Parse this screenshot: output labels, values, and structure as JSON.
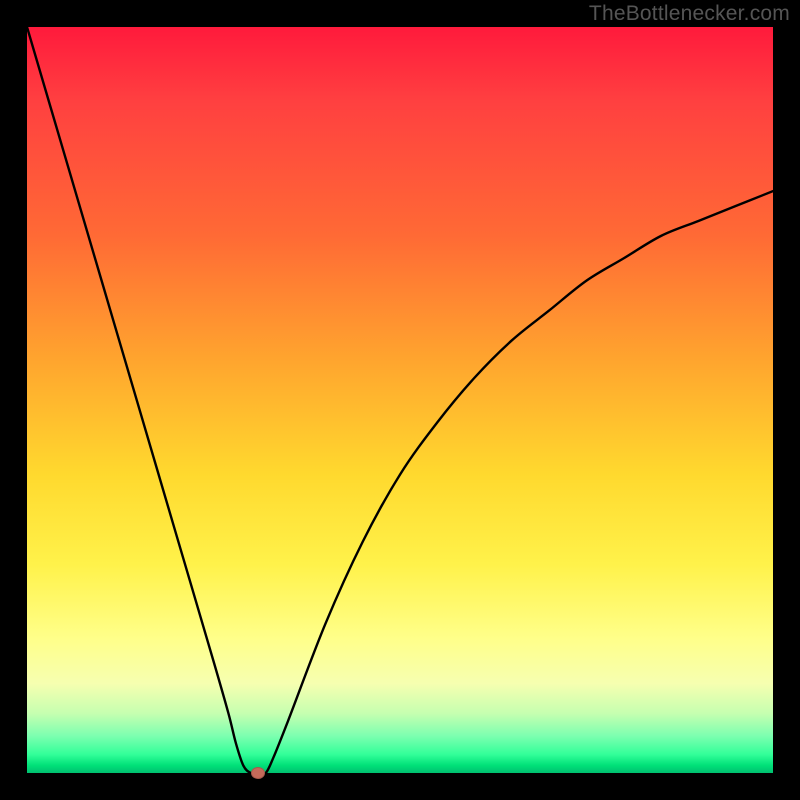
{
  "watermark": "TheBottlenecker.com",
  "chart_data": {
    "type": "line",
    "title": "",
    "xlabel": "",
    "ylabel": "",
    "xlim": [
      0,
      100
    ],
    "ylim": [
      0,
      100
    ],
    "x": [
      0,
      5,
      10,
      15,
      20,
      25,
      27,
      28,
      29,
      30,
      31,
      32,
      33,
      35,
      40,
      45,
      50,
      55,
      60,
      65,
      70,
      75,
      80,
      85,
      90,
      95,
      100
    ],
    "y": [
      100,
      83,
      66,
      49,
      32,
      15,
      8,
      4,
      1,
      0,
      0,
      0,
      2,
      7,
      20,
      31,
      40,
      47,
      53,
      58,
      62,
      66,
      69,
      72,
      74,
      76,
      78
    ],
    "marker": {
      "x": 31,
      "y": 0
    },
    "colors": {
      "curve": "#000000",
      "marker": "#c46a5a",
      "gradient_top": "#ff1a3c",
      "gradient_mid": "#ffd92e",
      "gradient_bottom": "#00c070"
    }
  }
}
